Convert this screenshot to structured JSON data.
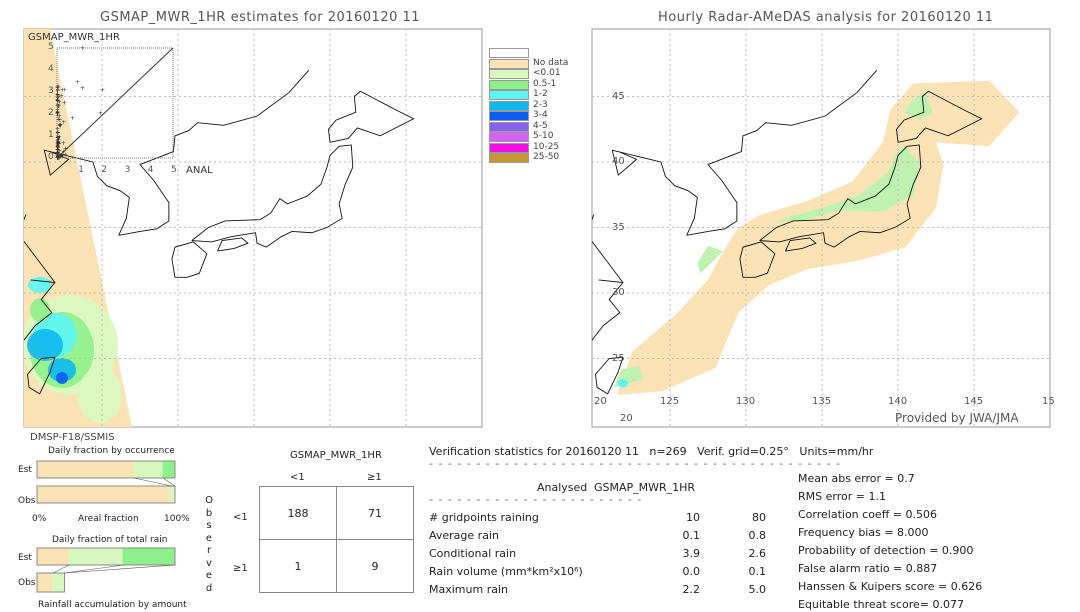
{
  "left_map": {
    "title": "GSMAP_MWR_1HR estimates for 20160120 11",
    "inset_label": "GSMAP_MWR_1HR",
    "inset_x_label": "ANAL",
    "inset_ticks": [
      "0",
      "1",
      "2",
      "3",
      "4",
      "5"
    ],
    "satellite": "DMSP-F18/SSMIS"
  },
  "right_map": {
    "title": "Hourly Radar-AMeDAS analysis for 20160120 11",
    "lat_labels": [
      "45",
      "40",
      "35",
      "30",
      "25",
      "20"
    ],
    "lon_labels": [
      "20",
      "125",
      "130",
      "135",
      "140",
      "145",
      "15"
    ],
    "credit": "Provided by JWA/JMA"
  },
  "legend": {
    "items": [
      {
        "label": "",
        "color": "#ffffff"
      },
      {
        "label": "No data",
        "color": "#fbe3b5"
      },
      {
        "label": "<0.01",
        "color": "#d8f8c0"
      },
      {
        "label": "0.5-1",
        "color": "#8ef08a"
      },
      {
        "label": "1-2",
        "color": "#5cf5f5"
      },
      {
        "label": "2-3",
        "color": "#10b8f0"
      },
      {
        "label": "3-4",
        "color": "#0c5cf0"
      },
      {
        "label": "4-5",
        "color": "#8a60f0"
      },
      {
        "label": "5-10",
        "color": "#d860f8"
      },
      {
        "label": "10-25",
        "color": "#f010e0"
      },
      {
        "label": "25-50",
        "color": "#c89838"
      }
    ]
  },
  "fraction": {
    "occurrence_title": "Daily fraction by occurrence",
    "est": "Est",
    "obs": "Obs",
    "pct0": "0%",
    "axis": "Areal fraction",
    "pct100": "100%",
    "total_title": "Daily fraction of total rain",
    "accum_title": "Rainfall accumulation by amount",
    "occ_est": [
      0.7,
      0.21,
      0.09
    ],
    "occ_obs": [
      0.96,
      0.04,
      0
    ],
    "tot_est": [
      0.23,
      0.39,
      0.38
    ],
    "tot_obs": [
      0.56,
      0.44,
      0
    ]
  },
  "contingency": {
    "title": "GSMAP_MWR_1HR",
    "col_headers": [
      "<1",
      "≥1"
    ],
    "row_headers": [
      "<1",
      "≥1"
    ],
    "observed_label": "Observed",
    "cells": [
      [
        "188",
        "71"
      ],
      [
        "1",
        "9"
      ]
    ]
  },
  "verification": {
    "header": "Verification statistics for 20160120 11   n=269   Verif. grid=0.25°   Units=mm/hr",
    "col_analysed": "Analysed",
    "col_gsmap": "GSMAP_MWR_1HR",
    "rows": [
      {
        "label": "# gridpoints raining",
        "a": "10",
        "g": "80"
      },
      {
        "label": "Average rain",
        "a": "0.1",
        "g": "0.8"
      },
      {
        "label": "Conditional rain",
        "a": "3.9",
        "g": "2.6"
      },
      {
        "label": "Rain volume (mm*km²x10⁶)",
        "a": "0.0",
        "g": "0.1"
      },
      {
        "label": "Maximum rain",
        "a": "2.2",
        "g": "5.0"
      }
    ],
    "scores": [
      "Mean abs error = 0.7",
      "RMS error = 1.1",
      "Correlation coeff = 0.506",
      "Frequency bias = 8.000",
      "Probability of detection = 0.900",
      "False alarm ratio = 0.887",
      "Hanssen & Kuipers score = 0.626",
      "Equitable threat score= 0.077"
    ]
  }
}
